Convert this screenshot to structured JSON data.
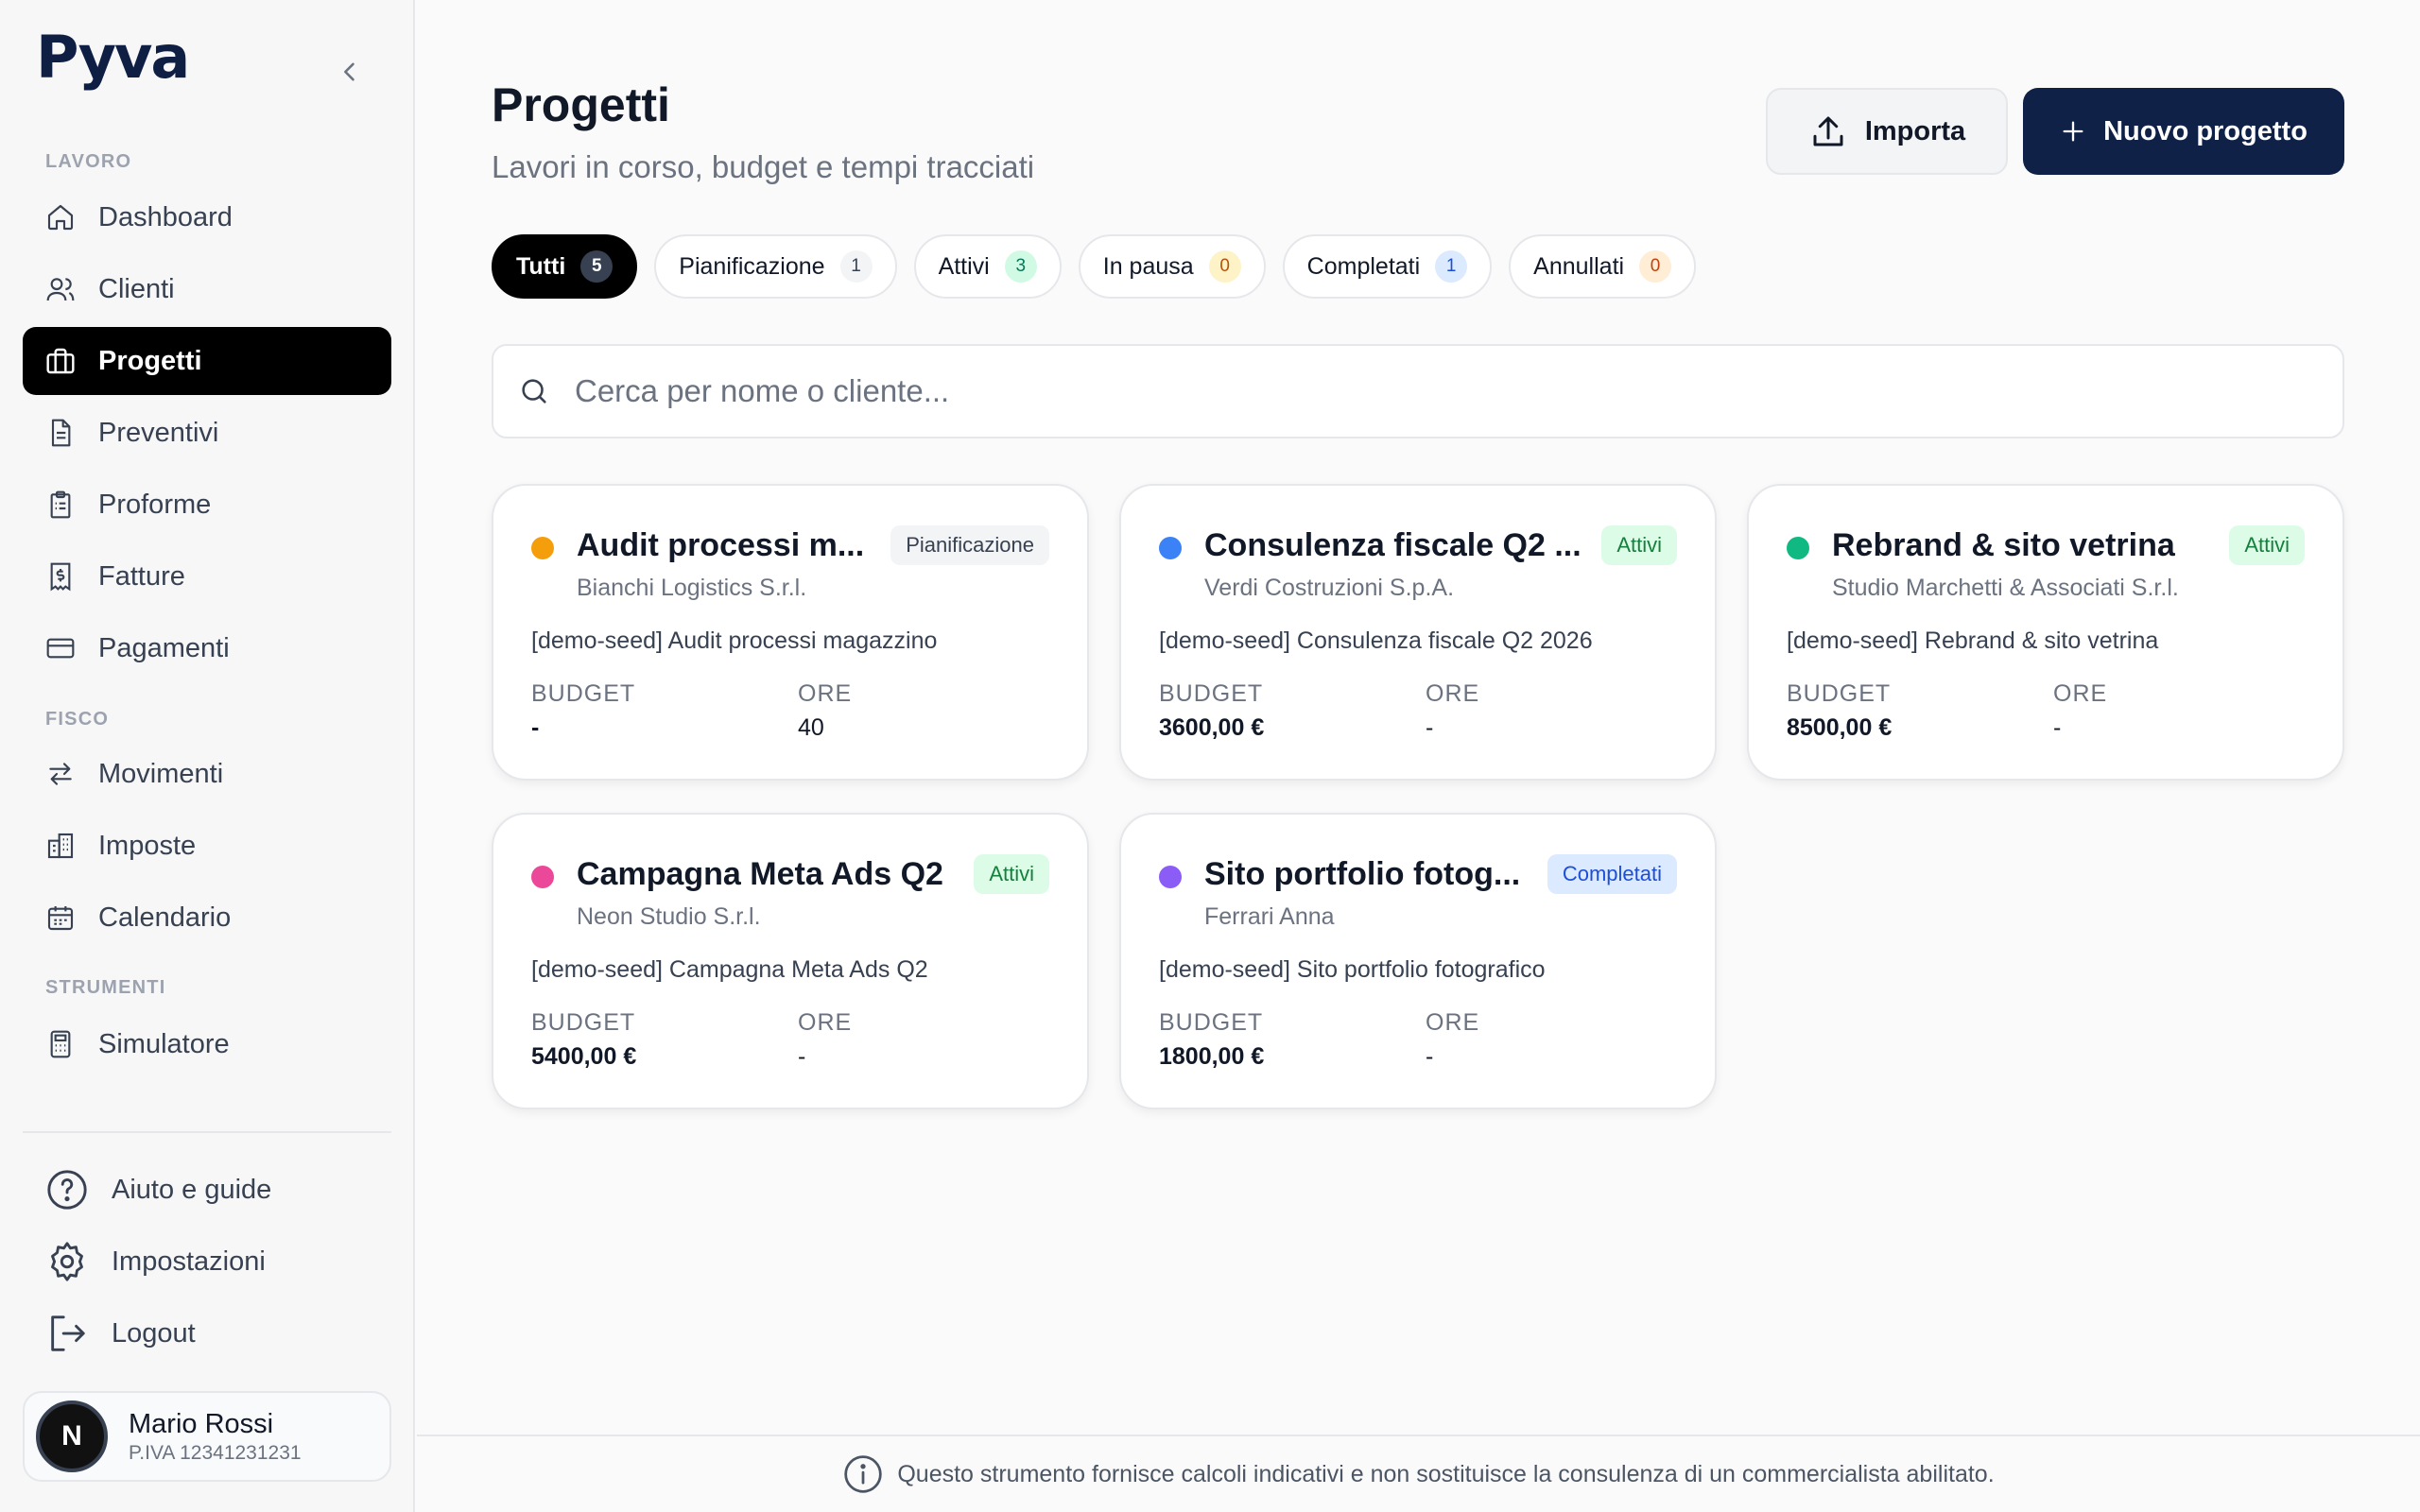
{
  "brand": {
    "logo_text": "Pyva"
  },
  "sidebar": {
    "sections": [
      {
        "label": "LAVORO"
      },
      {
        "label": "FISCO"
      },
      {
        "label": "STRUMENTI"
      }
    ],
    "items": [
      {
        "label": "Dashboard",
        "icon": "home-icon",
        "active": false
      },
      {
        "label": "Clienti",
        "icon": "users-icon",
        "active": false
      },
      {
        "label": "Progetti",
        "icon": "briefcase-icon",
        "active": true
      },
      {
        "label": "Preventivi",
        "icon": "document-icon",
        "active": false
      },
      {
        "label": "Proforme",
        "icon": "clipboard-icon",
        "active": false
      },
      {
        "label": "Fatture",
        "icon": "receipt-icon",
        "active": false
      },
      {
        "label": "Pagamenti",
        "icon": "credit-card-icon",
        "active": false
      },
      {
        "label": "Movimenti",
        "icon": "arrows-icon",
        "active": false
      },
      {
        "label": "Imposte",
        "icon": "building-icon",
        "active": false
      },
      {
        "label": "Calendario",
        "icon": "calendar-icon",
        "active": false
      },
      {
        "label": "Simulatore",
        "icon": "calculator-icon",
        "active": false
      }
    ],
    "bottom": [
      {
        "label": "Aiuto e guide",
        "icon": "help-icon"
      },
      {
        "label": "Impostazioni",
        "icon": "gear-icon"
      },
      {
        "label": "Logout",
        "icon": "logout-icon"
      }
    ],
    "user": {
      "initial": "N",
      "name": "Mario Rossi",
      "vat": "P.IVA 12341231231"
    }
  },
  "header": {
    "title": "Progetti",
    "subtitle": "Lavori in corso, budget e tempi tracciati",
    "import_label": "Importa",
    "new_label": "Nuovo progetto"
  },
  "filters": [
    {
      "label": "Tutti",
      "count": "5",
      "active": true
    },
    {
      "label": "Pianificazione",
      "count": "1",
      "active": false
    },
    {
      "label": "Attivi",
      "count": "3",
      "active": false
    },
    {
      "label": "In pausa",
      "count": "0",
      "active": false
    },
    {
      "label": "Completati",
      "count": "1",
      "active": false
    },
    {
      "label": "Annullati",
      "count": "0",
      "active": false
    }
  ],
  "filter_colors": [
    "#374151",
    "#f3f4f6",
    "#d1fae5",
    "#fef3c7",
    "#dbeafe",
    "#ffedd5"
  ],
  "filter_text_colors": [
    "#ffffff",
    "#374151",
    "#047857",
    "#b45309",
    "#1d4ed8",
    "#c2410c"
  ],
  "search": {
    "placeholder": "Cerca per nome o cliente..."
  },
  "projects": [
    {
      "title": "Audit processi m...",
      "client": "Bianchi Logistics S.r.l.",
      "desc": "[demo-seed] Audit processi magazzino",
      "badge": "Pianificazione",
      "badge_bg": "#f3f4f6",
      "badge_fg": "#374151",
      "dot": "#f59e0b",
      "budget_label": "BUDGET",
      "budget": "-",
      "hours_label": "ORE",
      "hours": "40"
    },
    {
      "title": "Consulenza fiscale Q2 ...",
      "client": "Verdi Costruzioni S.p.A.",
      "desc": "[demo-seed] Consulenza fiscale Q2 2026",
      "badge": "Attivi",
      "badge_bg": "#dcfce7",
      "badge_fg": "#15803d",
      "dot": "#3b82f6",
      "budget_label": "BUDGET",
      "budget": "3600,00 €",
      "hours_label": "ORE",
      "hours": "-"
    },
    {
      "title": "Rebrand & sito vetrina",
      "client": "Studio Marchetti & Associati S.r.l.",
      "desc": "[demo-seed] Rebrand & sito vetrina",
      "badge": "Attivi",
      "badge_bg": "#dcfce7",
      "badge_fg": "#15803d",
      "dot": "#10b981",
      "budget_label": "BUDGET",
      "budget": "8500,00 €",
      "hours_label": "ORE",
      "hours": "-"
    },
    {
      "title": "Campagna Meta Ads Q2",
      "client": "Neon Studio S.r.l.",
      "desc": "[demo-seed] Campagna Meta Ads Q2",
      "badge": "Attivi",
      "badge_bg": "#dcfce7",
      "badge_fg": "#15803d",
      "dot": "#ec4899",
      "budget_label": "BUDGET",
      "budget": "5400,00 €",
      "hours_label": "ORE",
      "hours": "-"
    },
    {
      "title": "Sito portfolio fotog...",
      "client": "Ferrari Anna",
      "desc": "[demo-seed] Sito portfolio fotografico",
      "badge": "Completati",
      "badge_bg": "#dbeafe",
      "badge_fg": "#1d4ed8",
      "dot": "#8b5cf6",
      "budget_label": "BUDGET",
      "budget": "1800,00 €",
      "hours_label": "ORE",
      "hours": "-"
    }
  ],
  "footer": {
    "note": "Questo strumento fornisce calcoli indicativi e non sostituisce la consulenza di un commercialista abilitato."
  }
}
